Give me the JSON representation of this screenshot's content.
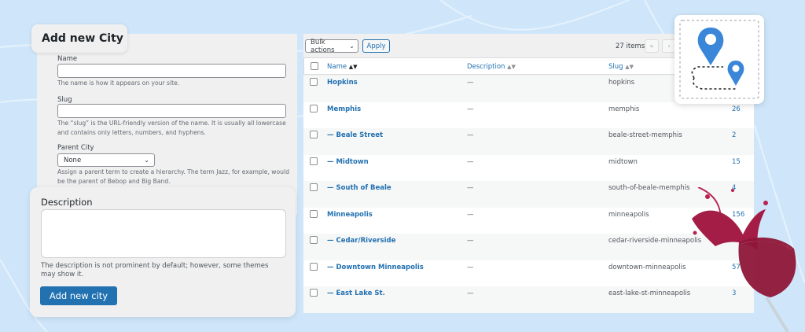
{
  "form": {
    "header": "Add new City",
    "name_label": "Name",
    "name_value": "",
    "name_help": "The name is how it appears on your site.",
    "slug_label": "Slug",
    "slug_value": "",
    "slug_help": "The “slug” is the URL-friendly version of the name. It is usually all lowercase and contains only letters, numbers, and hyphens.",
    "parent_label": "Parent City",
    "parent_value": "None",
    "parent_help": "Assign a parent term to create a hierarchy. The term Jazz, for example, would be the parent of Bebop and Big Band.",
    "description_label": "Description",
    "description_value": "",
    "description_help": "The description is not prominent by default; however, some themes may show it.",
    "submit_label": "Add new city"
  },
  "table": {
    "bulk_actions_label": "Bulk actions",
    "apply_label": "Apply",
    "items_count": "27 items",
    "first_page": "«",
    "prev_page": "‹",
    "columns": {
      "name": "Name",
      "description": "Description",
      "slug": "Slug"
    },
    "rows": [
      {
        "name": "Hopkins",
        "description": "—",
        "slug": "hopkins",
        "count": ""
      },
      {
        "name": "Memphis",
        "description": "—",
        "slug": "memphis",
        "count": "26"
      },
      {
        "name": "— Beale Street",
        "description": "—",
        "slug": "beale-street-memphis",
        "count": "2"
      },
      {
        "name": "— Midtown",
        "description": "—",
        "slug": "midtown",
        "count": "15"
      },
      {
        "name": "— South of Beale",
        "description": "—",
        "slug": "south-of-beale-memphis",
        "count": "4"
      },
      {
        "name": "Minneapolis",
        "description": "—",
        "slug": "minneapolis",
        "count": "156"
      },
      {
        "name": "— Cedar/Riverside",
        "description": "—",
        "slug": "cedar-riverside-minneapolis",
        "count": ""
      },
      {
        "name": "— Downtown Minneapolis",
        "description": "—",
        "slug": "downtown-minneapolis",
        "count": "57"
      },
      {
        "name": "— East Lake St.",
        "description": "—",
        "slug": "east-lake-st-minneapolis",
        "count": "3"
      }
    ]
  },
  "colors": {
    "background": "#cfe6fa",
    "accent": "#2271b1",
    "pin": "#3a86d8",
    "wine": "#9b1b40"
  },
  "icons": [
    "chevron-down-icon",
    "sort-icon",
    "map-pin-icon",
    "route-icon",
    "wine-glass-icon"
  ]
}
